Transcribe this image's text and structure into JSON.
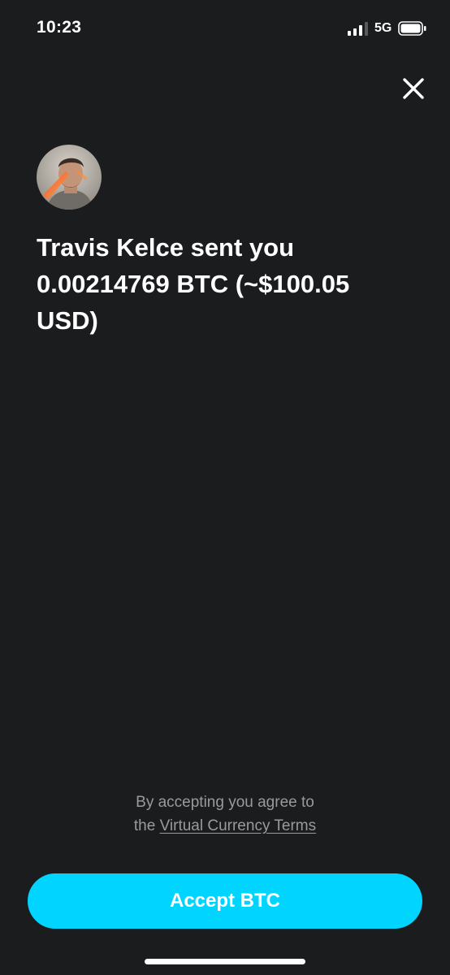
{
  "status_bar": {
    "time": "10:23",
    "network": "5G",
    "icons": [
      "signal-bars-icon",
      "battery-icon"
    ]
  },
  "header": {
    "close_icon": "close-icon"
  },
  "sender": {
    "avatar": "profile-photo"
  },
  "message": {
    "line1": "Travis Kelce sent you",
    "line2": "0.00214769 BTC (~$100.05",
    "line3": "USD)"
  },
  "terms": {
    "line1": "By accepting you agree to",
    "prefix": "the",
    "link": "Virtual Currency Terms"
  },
  "actions": {
    "accept_label": "Accept BTC"
  },
  "colors": {
    "background": "#1b1c1e",
    "accent": "#00d4ff",
    "muted_text": "#9a9a9d"
  }
}
